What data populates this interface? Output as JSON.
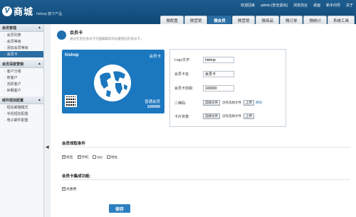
{
  "header": {
    "logo_letter": "V",
    "logo_text": "商城",
    "logo_sub": "hishop 旗下产品",
    "top_links": [
      "欢迎回来",
      "admin [安全退出]",
      "浏览前台",
      "桌面",
      "新手向导",
      "关于"
    ],
    "tabs": [
      "微配置",
      "微营销",
      "微会员",
      "微营销",
      "微商品",
      "微订单",
      "微统计",
      "系统工具"
    ],
    "active_tab": 2
  },
  "sidebar": {
    "groups": [
      {
        "title": "会员管理",
        "items": [
          "会员列表",
          "会员等级",
          "添加会员等级",
          "会员卡"
        ]
      },
      {
        "title": "会员深度营销",
        "items": [
          "客户分组",
          "新客户",
          "活跃客户",
          "休眠客户"
        ]
      },
      {
        "title": "邮件短信配置",
        "items": [
          "短信邮箱模式",
          "手机短信配置",
          "电子邮件配置"
        ]
      }
    ],
    "active_item": "会员卡"
  },
  "page": {
    "title": "会员卡",
    "subtitle": "通过在后台会员卡页面编辑您的设置相应的会员卡。"
  },
  "card": {
    "brand": "hishop",
    "card_name": "会员卡",
    "level": "普通会员",
    "number": "100000"
  },
  "form": {
    "logo_label": "Logo文字:",
    "logo_value": "hishop",
    "card_name_label": "会员卡名:",
    "card_name_value": "会员卡",
    "prefix_label": "会员卡前缀:",
    "prefix_value": "100000",
    "qrcode_label": "二维码:",
    "bg_label": "卡片背景:",
    "choose_file": "选择文件",
    "no_file": "没有选择文件",
    "upload": "上传",
    "remove": "移除"
  },
  "conditions": {
    "title": "会员领取条件",
    "items": [
      {
        "label": "姓名",
        "checked": true
      },
      {
        "label": "手机",
        "checked": true
      },
      {
        "label": "QQ",
        "checked": false
      },
      {
        "label": "地址",
        "checked": false
      }
    ]
  },
  "integration": {
    "title": "会员卡集成功能:",
    "items": [
      {
        "label": "优惠券",
        "checked": true
      }
    ]
  },
  "save_label": "保存"
}
